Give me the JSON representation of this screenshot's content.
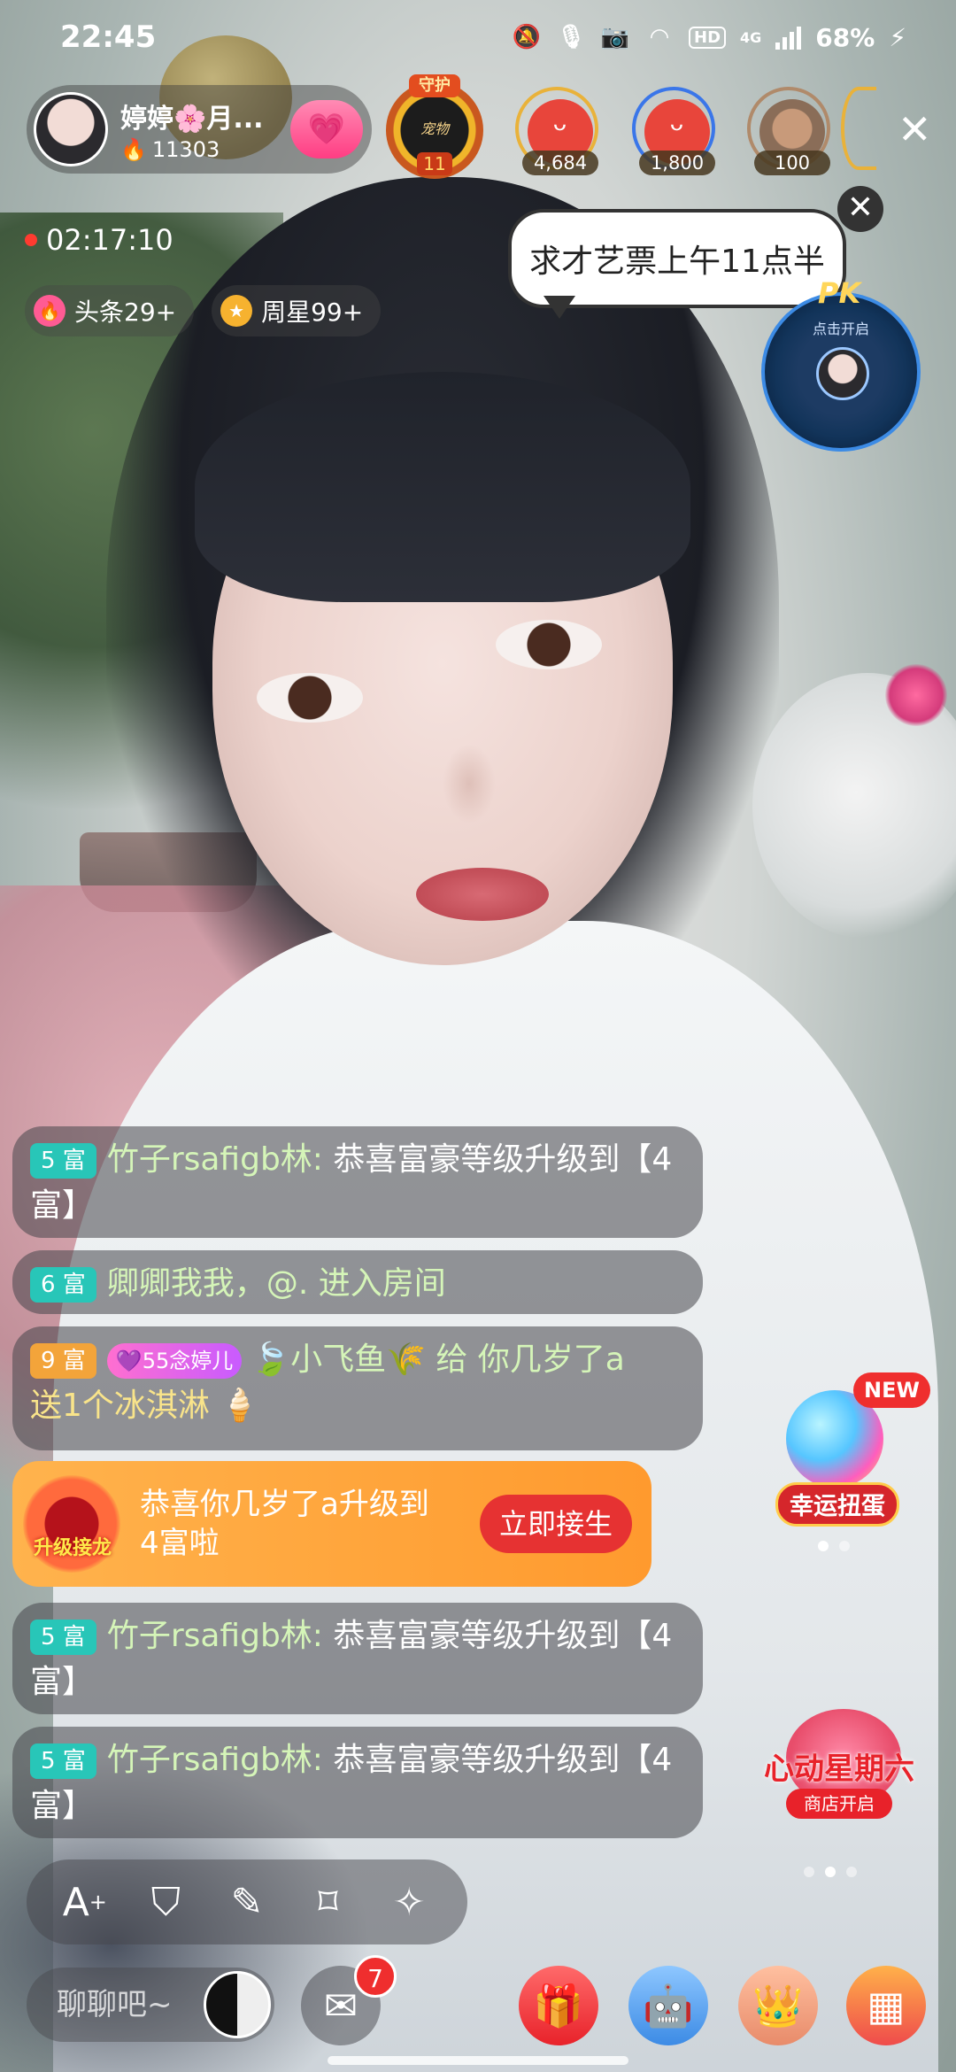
{
  "status_bar": {
    "time": "22:45",
    "network": "4G",
    "hd": "HD",
    "battery": "68%"
  },
  "host": {
    "name": "婷婷🌸月...",
    "fans": "11303"
  },
  "guard": {
    "label": "守护",
    "sub": "宠物",
    "count": "11"
  },
  "viewers": [
    {
      "score": "4,684"
    },
    {
      "score": "1,800"
    },
    {
      "score": "100"
    }
  ],
  "live_timer": "02:17:10",
  "chips": [
    {
      "label": "头条29+"
    },
    {
      "label": "周星99+"
    }
  ],
  "bubble_text": "求才艺票上午11点半",
  "pk": {
    "label": "PK",
    "sub": "点击开启"
  },
  "chat": {
    "messages": [
      {
        "level": "5 富",
        "user": "竹子rsafigb林:",
        "text": " 恭喜富豪等级升级到【4富】"
      },
      {
        "level": "6 富",
        "user": "卿卿我我，@. 进入房间",
        "text": ""
      },
      {
        "level": "9 富",
        "badge": "念婷儿",
        "badge_level": "55",
        "user": "小飞鱼",
        "text": " 给 你几岁了a",
        "gift": "送1个冰淇淋"
      },
      {
        "level": "5 富",
        "user": "竹子rsafigb林:",
        "text": " 恭喜富豪等级升级到【4富】"
      },
      {
        "level": "5 富",
        "user": "竹子rsafigb林:",
        "text": " 恭喜富豪等级升级到【4富】"
      }
    ],
    "promo": {
      "icon_label": "升级接龙",
      "text": "恭喜你几岁了a升级到4富啦",
      "button": "立即接生"
    }
  },
  "side_widgets": {
    "capsule": {
      "new": "NEW",
      "label": "幸运扭蛋"
    },
    "heart": {
      "title": "心动星期六",
      "sub": "商店开启"
    }
  },
  "toolbar_icons": [
    "font-size-icon",
    "guard-shield-icon",
    "edit-note-icon",
    "tag-icon",
    "magic-wand-icon"
  ],
  "bottom": {
    "placeholder": "聊聊吧~",
    "mail_badge": "7"
  }
}
